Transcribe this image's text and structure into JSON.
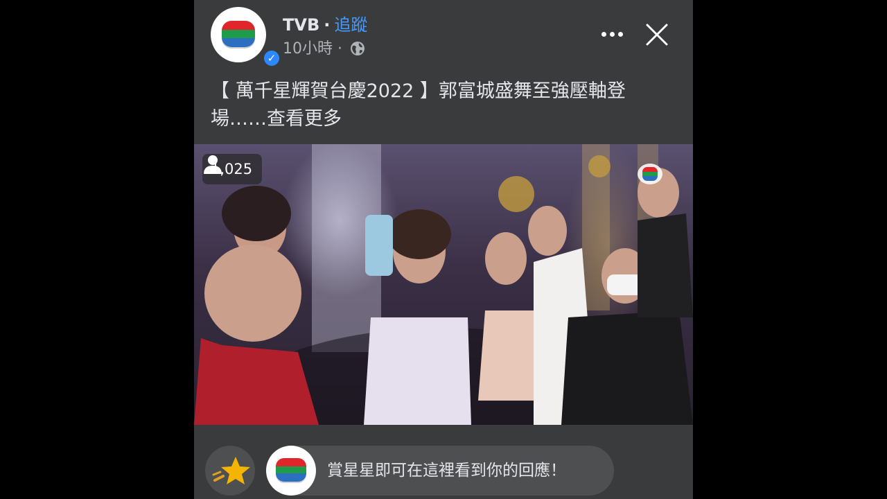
{
  "post": {
    "page_name": "TVB",
    "separator": "·",
    "follow_label": "追蹤",
    "time_ago": "10小時",
    "meta_separator": "·",
    "privacy_icon": "globe-icon",
    "more_icon": "more-horizontal-icon",
    "close_icon": "close-icon",
    "verified_icon": "check-badge-icon",
    "caption_text": "【 萬千星輝賀台慶2022 】郭富城盛舞至強壓軸登場……",
    "see_more_label": "查看更多"
  },
  "video": {
    "viewer_icon": "person-icon",
    "viewer_count": "1,025",
    "watermark_icon": "tvb-logo-icon"
  },
  "stars": {
    "star_icon": "star-icon",
    "prompt_text": "賞星星即可在這裡看到你的回應！"
  },
  "colors": {
    "background": "#3a3b3c",
    "follow_link": "#4599ff",
    "verified_badge": "#2d88ff",
    "text_primary": "#e4e6eb",
    "text_secondary": "#b0b3b8",
    "tvb_red": "#e0262b",
    "tvb_green": "#1e9c4a",
    "tvb_blue": "#2c6fc0"
  }
}
